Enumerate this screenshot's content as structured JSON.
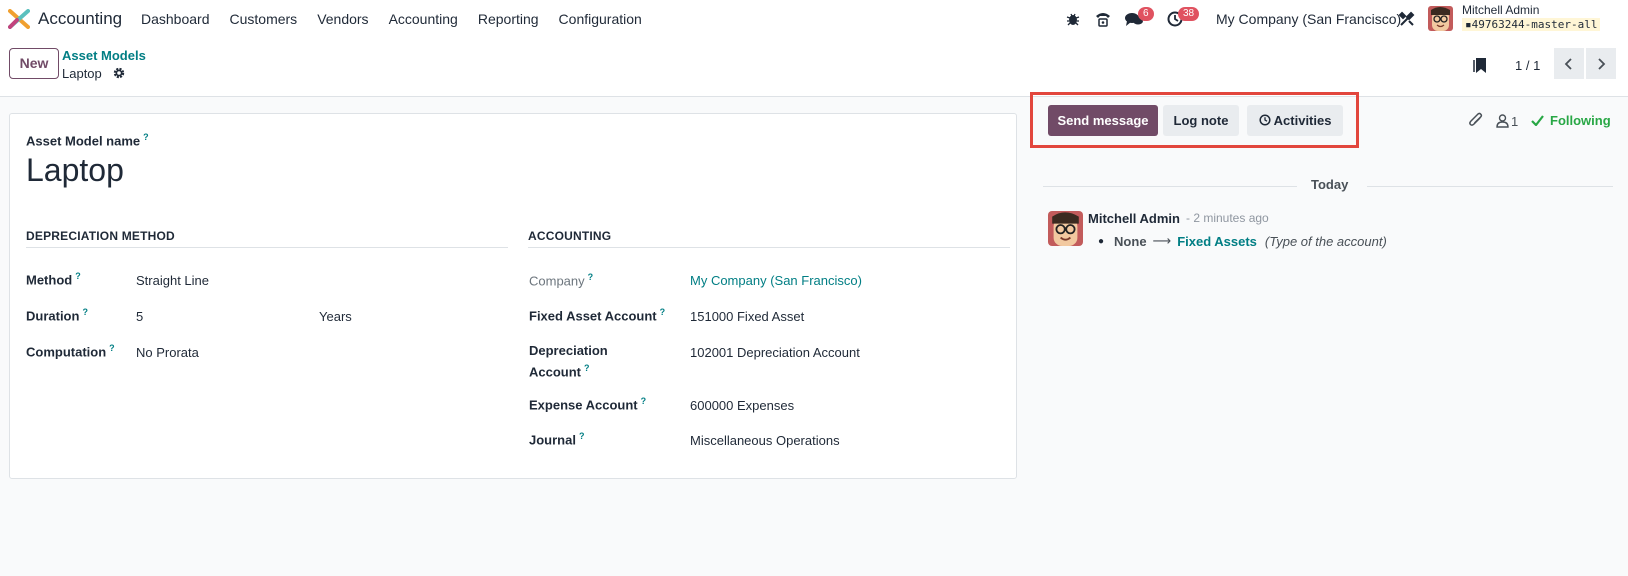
{
  "app": {
    "name": "Accounting"
  },
  "menu": [
    "Dashboard",
    "Customers",
    "Vendors",
    "Accounting",
    "Reporting",
    "Configuration"
  ],
  "systray": {
    "messages_count": "6",
    "activities_count": "38",
    "company": "My Company (San Francisco)"
  },
  "user": {
    "name": "Mitchell Admin",
    "database": "49763244-master-all"
  },
  "control": {
    "new_label": "New",
    "breadcrumb_parent": "Asset Models",
    "breadcrumb_current": "Laptop",
    "pager": "1 / 1"
  },
  "form": {
    "name_label": "Asset Model name",
    "name_value": "Laptop",
    "depreciation_section": "DEPRECIATION METHOD",
    "accounting_section": "ACCOUNTING",
    "method_label": "Method",
    "method_value": "Straight Line",
    "duration_label": "Duration",
    "duration_value": "5",
    "duration_unit": "Years",
    "computation_label": "Computation",
    "computation_value": "No Prorata",
    "company_label": "Company",
    "company_value": "My Company (San Francisco)",
    "fixed_asset_label": "Fixed Asset Account",
    "fixed_asset_value": "151000 Fixed Asset",
    "depreciation_label_1": "Depreciation",
    "depreciation_label_2": "Account",
    "depreciation_value": "102001 Depreciation Account",
    "expense_label": "Expense Account",
    "expense_value": "600000 Expenses",
    "journal_label": "Journal",
    "journal_value": "Miscellaneous Operations"
  },
  "chatter": {
    "send_message": "Send message",
    "log_note": "Log note",
    "activities": "Activities",
    "followers_count": "1",
    "following": "Following",
    "date_separator": "Today",
    "message": {
      "author": "Mitchell Admin",
      "time": "- 2 minutes ago",
      "old_value": "None",
      "new_value": "Fixed Assets",
      "field": "(Type of the account)"
    }
  },
  "colors": {
    "brand": "#714b67",
    "link": "#017e84",
    "highlight": "#e2463d",
    "following": "#28a745"
  }
}
